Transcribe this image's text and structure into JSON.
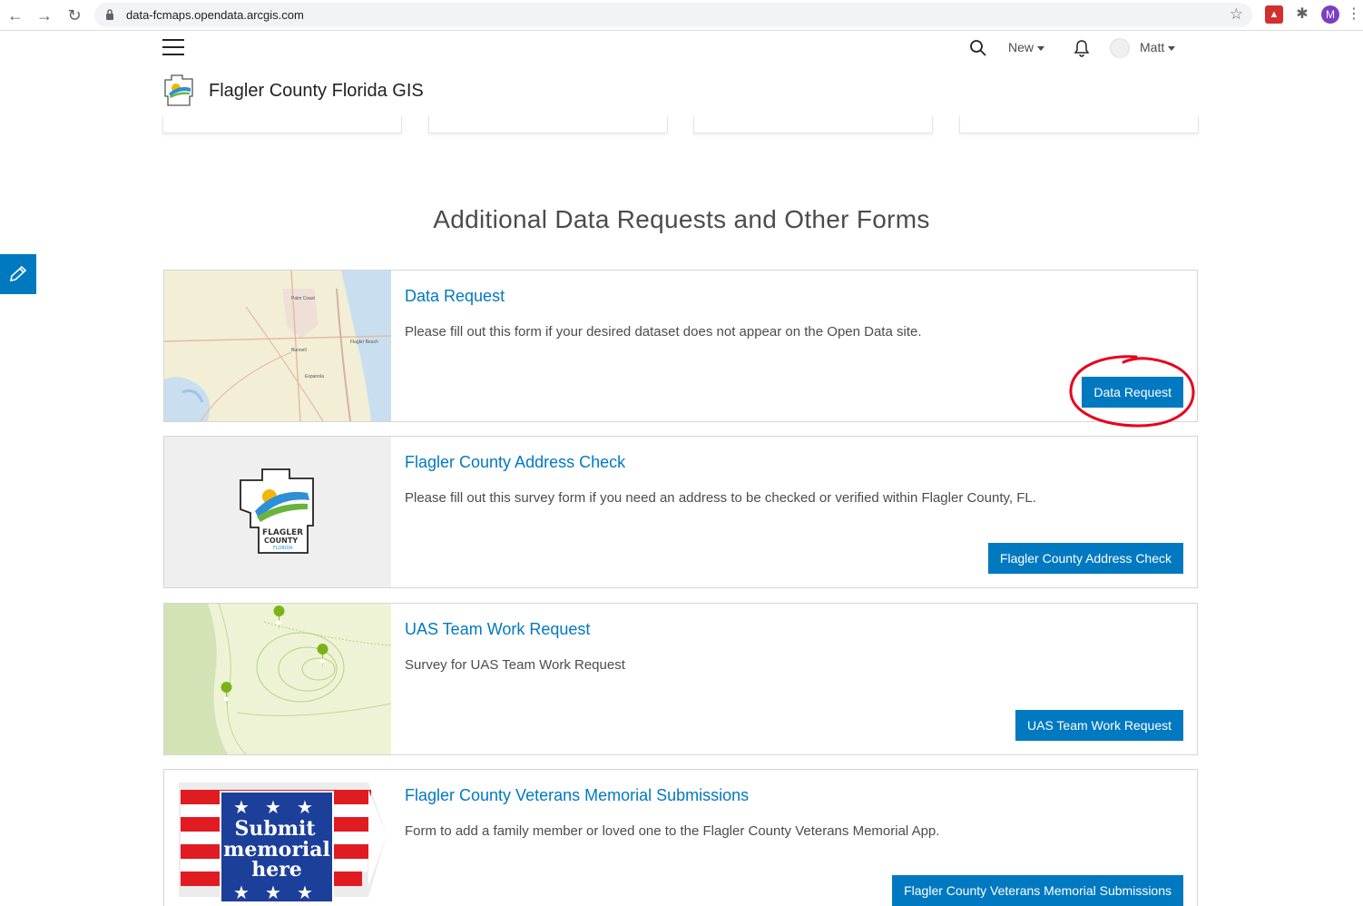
{
  "browser": {
    "url": "data-fcmaps.opendata.arcgis.com",
    "profile_initial": "M"
  },
  "header": {
    "new_label": "New",
    "user_name": "Matt",
    "site_title": "Flagler County Florida GIS"
  },
  "section": {
    "heading": "Additional Data Requests and Other Forms"
  },
  "cards": [
    {
      "title": "Data Request",
      "description": "Please fill out this form if your desired dataset does not appear on the Open Data site.",
      "button": "Data Request"
    },
    {
      "title": "Flagler County Address Check",
      "description": "Please fill out this survey form if you need an address to be checked or verified within Flagler County, FL.",
      "button": "Flagler County Address Check"
    },
    {
      "title": "UAS Team Work Request",
      "description": "Survey for UAS Team Work Request",
      "button": "UAS Team Work Request"
    },
    {
      "title": "Flagler County Veterans Memorial Submissions",
      "description": "Form to add a family member or loved one to the Flagler County Veterans Memorial App.",
      "button": "Flagler County Veterans Memorial Submissions"
    }
  ],
  "thumbnails": {
    "map_labels": [
      "Palm Coast",
      "Bunnell",
      "Flagler Beach",
      "Espanola"
    ],
    "logo_text": [
      "FLAGLER",
      "COUNTY",
      "FLORIDA"
    ],
    "memorial_text": [
      "Submit",
      "memorial",
      "here"
    ]
  },
  "colors": {
    "brand_blue": "#0079c1",
    "annotation_red": "#e8001c"
  }
}
